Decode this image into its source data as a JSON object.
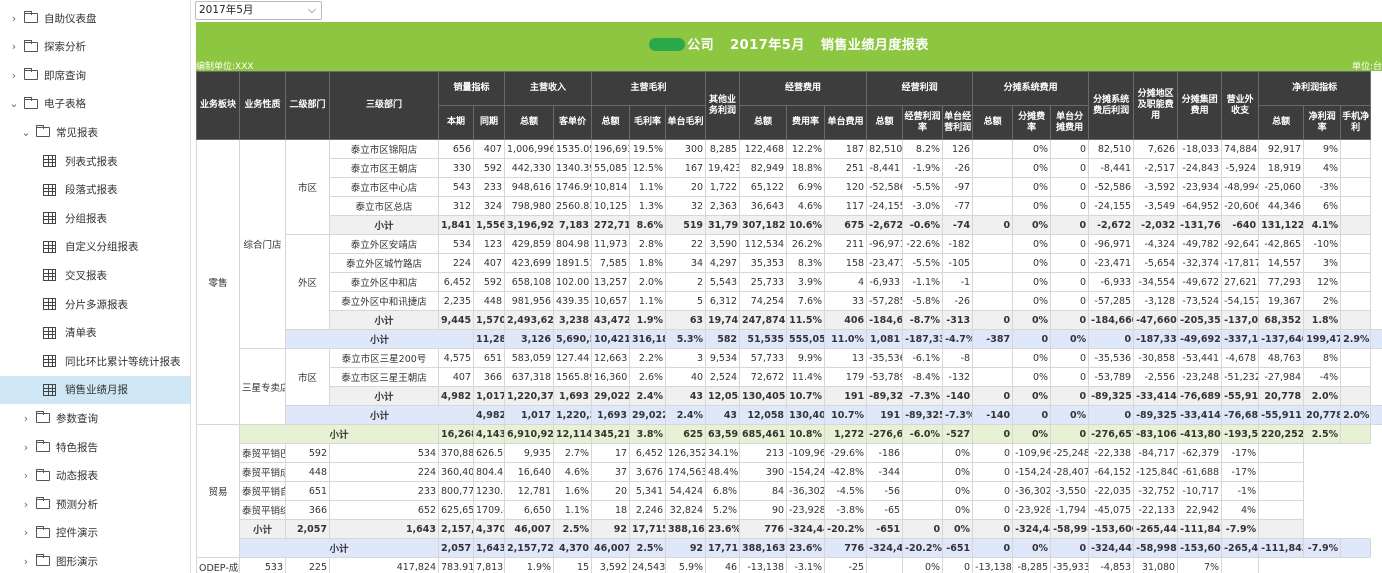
{
  "sidebar": {
    "items": [
      {
        "label": "自助仪表盘",
        "type": "folder",
        "level": 0,
        "chev": "›"
      },
      {
        "label": "探索分析",
        "type": "folder",
        "level": 0,
        "chev": "›"
      },
      {
        "label": "即席查询",
        "type": "folder",
        "level": 0,
        "chev": "›"
      },
      {
        "label": "电子表格",
        "type": "folder",
        "level": 0,
        "chev": "⌄"
      },
      {
        "label": "常见报表",
        "type": "folder",
        "level": 1,
        "chev": "⌄"
      },
      {
        "label": "列表式报表",
        "type": "report",
        "level": 2
      },
      {
        "label": "段落式报表",
        "type": "report",
        "level": 2
      },
      {
        "label": "分组报表",
        "type": "report",
        "level": 2
      },
      {
        "label": "自定义分组报表",
        "type": "report",
        "level": 2
      },
      {
        "label": "交叉报表",
        "type": "report",
        "level": 2
      },
      {
        "label": "分片多源报表",
        "type": "report",
        "level": 2
      },
      {
        "label": "清单表",
        "type": "report",
        "level": 2
      },
      {
        "label": "同比环比累计等统计报表",
        "type": "report",
        "level": 2
      },
      {
        "label": "销售业绩月报",
        "type": "report",
        "level": 2,
        "selected": true
      },
      {
        "label": "参数查询",
        "type": "folder",
        "level": 1,
        "chev": "›"
      },
      {
        "label": "特色报告",
        "type": "folder",
        "level": 1,
        "chev": "›"
      },
      {
        "label": "动态报表",
        "type": "folder",
        "level": 1,
        "chev": "›"
      },
      {
        "label": "预测分析",
        "type": "folder",
        "level": 1,
        "chev": "›"
      },
      {
        "label": "控件演示",
        "type": "folder",
        "level": 1,
        "chev": "›"
      },
      {
        "label": "图形演示",
        "type": "folder",
        "level": 1,
        "chev": "›"
      }
    ]
  },
  "date_select": {
    "value": "2017年5月",
    "arrow": "⌵"
  },
  "report": {
    "title_company": "公司",
    "title_month": "2017年5月",
    "title_name": "销售业绩月度报表",
    "unit_left": "编制单位:XXX",
    "unit_right": "单位:台",
    "header_top": [
      "业务板块",
      "业务性质",
      "二级部门",
      "三级部门",
      "销量指标",
      "主营收入",
      "主营毛利",
      "其他业务利润",
      "经营费用",
      "经营利润",
      "分摊系统费用",
      "分摊系统费后利润",
      "分摊地区及职能费用",
      "分摊集团费用",
      "营业外收支",
      "净利润指标"
    ],
    "header_sub": [
      "本期",
      "同期",
      "总额",
      "客单价",
      "总额",
      "毛利率",
      "单台毛利",
      "总额",
      "费用率",
      "单台费用",
      "总额",
      "经营利润率",
      "单台经营利润",
      "总额",
      "分摊费率",
      "单台分摊费用",
      "总额",
      "净利润率",
      "手机净利"
    ],
    "rows": [
      {
        "k": "d",
        "c3": "泰立市区锦阳店",
        "v": [
          "656",
          "407",
          "1,006,996",
          "1535.05",
          "196,693",
          "19.5%",
          "300",
          "8,285",
          "122,468",
          "12.2%",
          "187",
          "82,510",
          "8.2%",
          "126",
          "",
          "0%",
          "0",
          "82,510",
          "7,626",
          "-18,033",
          "74,884",
          "92,917",
          "9%",
          ""
        ]
      },
      {
        "k": "d",
        "c3": "泰立市区王朝店",
        "v": [
          "330",
          "592",
          "442,330",
          "1340.39",
          "55,085",
          "12.5%",
          "167",
          "19,423",
          "82,949",
          "18.8%",
          "251",
          "-8,441",
          "-1.9%",
          "-26",
          "",
          "0%",
          "0",
          "-8,441",
          "-2,517",
          "-24,843",
          "-5,924",
          "18,919",
          "4%",
          ""
        ]
      },
      {
        "k": "d",
        "c3": "泰立市区中心店",
        "v": [
          "543",
          "233",
          "948,616",
          "1746.99",
          "10,814",
          "1.1%",
          "20",
          "1,722",
          "65,122",
          "6.9%",
          "120",
          "-52,586",
          "-5.5%",
          "-97",
          "",
          "0%",
          "0",
          "-52,586",
          "-3,592",
          "-23,934",
          "-48,994",
          "-25,060",
          "-3%",
          ""
        ]
      },
      {
        "k": "d",
        "c3": "泰立市区总店",
        "v": [
          "312",
          "324",
          "798,980",
          "2560.83",
          "10,125",
          "1.3%",
          "32",
          "2,363",
          "36,643",
          "4.6%",
          "117",
          "-24,155",
          "-3.0%",
          "-77",
          "",
          "0%",
          "0",
          "-24,155",
          "-3,549",
          "-64,952",
          "-20,606",
          "44,346",
          "6%",
          ""
        ]
      },
      {
        "k": "s",
        "c3": "小计",
        "v": [
          "1,841",
          "1,556",
          "3,196,922",
          "7,183",
          "272,717",
          "8.6%",
          "519",
          "31,793",
          "307,182",
          "10.6%",
          "675",
          "-2,672",
          "-0.6%",
          "-74",
          "0",
          "0%",
          "0",
          "-2,672",
          "-2,032",
          "-131,762",
          "-640",
          "131,122",
          "4.1%",
          ""
        ]
      },
      {
        "k": "d",
        "c3": "泰立外区安靖店",
        "v": [
          "534",
          "123",
          "429,859",
          "804.98",
          "11,973",
          "2.8%",
          "22",
          "3,590",
          "112,534",
          "26.2%",
          "211",
          "-96,971",
          "-22.6%",
          "-182",
          "",
          "0%",
          "0",
          "-96,971",
          "-4,324",
          "-49,782",
          "-92,647",
          "-42,865",
          "-10%",
          ""
        ]
      },
      {
        "k": "d",
        "c3": "泰立外区城竹路店",
        "v": [
          "224",
          "407",
          "423,699",
          "1891.51",
          "7,585",
          "1.8%",
          "34",
          "4,297",
          "35,353",
          "8.3%",
          "158",
          "-23,471",
          "-5.5%",
          "-105",
          "",
          "0%",
          "0",
          "-23,471",
          "-5,654",
          "-32,374",
          "-17,817",
          "14,557",
          "3%",
          ""
        ]
      },
      {
        "k": "d",
        "c3": "泰立外区中和店",
        "v": [
          "6,452",
          "592",
          "658,108",
          "102.00",
          "13,257",
          "2.0%",
          "2",
          "5,543",
          "25,733",
          "3.9%",
          "4",
          "-6,933",
          "-1.1%",
          "-1",
          "",
          "0%",
          "0",
          "-6,933",
          "-34,554",
          "-49,672",
          "27,621",
          "77,293",
          "12%",
          ""
        ]
      },
      {
        "k": "d",
        "c3": "泰立外区中和讯捷店",
        "v": [
          "2,235",
          "448",
          "981,956",
          "439.35",
          "10,657",
          "1.1%",
          "5",
          "6,312",
          "74,254",
          "7.6%",
          "33",
          "-57,285",
          "-5.8%",
          "-26",
          "",
          "0%",
          "0",
          "-57,285",
          "-3,128",
          "-73,524",
          "-54,157",
          "19,367",
          "2%",
          ""
        ]
      },
      {
        "k": "s",
        "c3": "小计",
        "v": [
          "9,445",
          "1,570",
          "2,493,622",
          "3,238",
          "43,472",
          "1.9%",
          "63",
          "19,742",
          "247,874",
          "11.5%",
          "406",
          "-184,660",
          "-8.7%",
          "-313",
          "0",
          "0%",
          "0",
          "-184,660",
          "-47,660",
          "-205,352",
          "-137,000",
          "68,352",
          "1.8%",
          ""
        ]
      },
      {
        "k": "b",
        "c3": "小计",
        "v": [
          "11,286",
          "3,126",
          "5,690,544",
          "10,421",
          "316,189",
          "5.3%",
          "582",
          "51,535",
          "555,056",
          "11.0%",
          "1,081",
          "-187,332",
          "-4.7%",
          "-387",
          "0",
          "0%",
          "0",
          "-187,332",
          "-49,692",
          "-337,114",
          "-137,640",
          "199,473",
          "2.9%",
          ""
        ]
      },
      {
        "k": "d",
        "c3": "泰立市区三星200号",
        "v": [
          "4,575",
          "651",
          "583,059",
          "127.44",
          "12,663",
          "2.2%",
          "3",
          "9,534",
          "57,733",
          "9.9%",
          "13",
          "-35,536",
          "-6.1%",
          "-8",
          "",
          "0%",
          "0",
          "-35,536",
          "-30,858",
          "-53,441",
          "-4,678",
          "48,763",
          "8%",
          ""
        ]
      },
      {
        "k": "d",
        "c3": "泰立市区三星王朝店",
        "v": [
          "407",
          "366",
          "637,318",
          "1565.89",
          "16,360",
          "2.6%",
          "40",
          "2,524",
          "72,672",
          "11.4%",
          "179",
          "-53,789",
          "-8.4%",
          "-132",
          "",
          "0%",
          "0",
          "-53,789",
          "-2,556",
          "-23,248",
          "-51,232",
          "-27,984",
          "-4%",
          ""
        ]
      },
      {
        "k": "s",
        "c3": "小计",
        "v": [
          "4,982",
          "1,017",
          "1,220,377",
          "1,693",
          "29,022",
          "2.4%",
          "43",
          "12,058",
          "130,405",
          "10.7%",
          "191",
          "-89,325",
          "-7.3%",
          "-140",
          "0",
          "0%",
          "0",
          "-89,325",
          "-33,414",
          "-76,689",
          "-55,911",
          "20,778",
          "2.0%",
          ""
        ]
      },
      {
        "k": "b",
        "c3": "小计",
        "v": [
          "4,982",
          "1,017",
          "1,220,377",
          "1,693",
          "29,022",
          "2.4%",
          "43",
          "12,058",
          "130,405",
          "10.7%",
          "191",
          "-89,325",
          "-7.3%",
          "-140",
          "0",
          "0%",
          "0",
          "-89,325",
          "-33,414",
          "-76,689",
          "-55,911",
          "20,778",
          "2.0%",
          ""
        ]
      },
      {
        "k": "g",
        "c3": "小计",
        "v": [
          "16,268",
          "4,143",
          "6,910,921",
          "12,114",
          "345,211",
          "3.8%",
          "625",
          "63,593",
          "685,461",
          "10.8%",
          "1,272",
          "-276,657",
          "-6.0%",
          "-527",
          "0",
          "0%",
          "0",
          "-276,657",
          "-83,106",
          "-413,803",
          "-193,551",
          "220,252",
          "2.5%",
          ""
        ]
      },
      {
        "k": "d",
        "c3": "泰贸平销巴中地区",
        "v": [
          "592",
          "534",
          "370,888",
          "626.50",
          "9,935",
          "2.7%",
          "17",
          "6,452",
          "126,352",
          "34.1%",
          "213",
          "-109,965",
          "-29.6%",
          "-186",
          "",
          "0%",
          "0",
          "-109,965",
          "-25,248",
          "-22,338",
          "-84,717",
          "-62,379",
          "-17%",
          ""
        ]
      },
      {
        "k": "d",
        "c3": "泰贸平销成都市区",
        "v": [
          "448",
          "224",
          "360,404",
          "804.47",
          "16,640",
          "4.6%",
          "37",
          "3,676",
          "174,563",
          "48.4%",
          "390",
          "-154,247",
          "-42.8%",
          "-344",
          "",
          "0%",
          "0",
          "-154,247",
          "-28,407",
          "-64,152",
          "-125,840",
          "-61,688",
          "-17%",
          ""
        ]
      },
      {
        "k": "d",
        "c3": "泰贸平销自贡地区",
        "v": [
          "651",
          "233",
          "800,776",
          "1230.07",
          "12,781",
          "1.6%",
          "20",
          "5,341",
          "54,424",
          "6.8%",
          "84",
          "-36,302",
          "-4.5%",
          "-56",
          "",
          "0%",
          "0",
          "-36,302",
          "-3,550",
          "-22,035",
          "-32,752",
          "-10,717",
          "-1%",
          ""
        ]
      },
      {
        "k": "d",
        "c3": "泰贸平销综合事务部",
        "v": [
          "366",
          "652",
          "625,657",
          "1709.45",
          "6,650",
          "1.1%",
          "18",
          "2,246",
          "32,824",
          "5.2%",
          "90",
          "-23,928",
          "-3.8%",
          "-65",
          "",
          "0%",
          "0",
          "-23,928",
          "-1,794",
          "-45,075",
          "-22,133",
          "22,942",
          "4%",
          ""
        ]
      },
      {
        "k": "s",
        "c3": "小计",
        "v": [
          "2,057",
          "1,643",
          "2,157,725",
          "4,370",
          "46,007",
          "2.5%",
          "92",
          "17,715",
          "388,163",
          "23.6%",
          "776",
          "-324,441",
          "-20.2%",
          "-651",
          "0",
          "0%",
          "0",
          "-324,441",
          "-58,998",
          "-153,600",
          "-265,443",
          "-111,843",
          "-7.9%",
          ""
        ]
      },
      {
        "k": "b",
        "c3": "小计",
        "v": [
          "2,057",
          "1,643",
          "2,157,725",
          "4,370",
          "46,007",
          "2.5%",
          "92",
          "17,715",
          "388,163",
          "23.6%",
          "776",
          "-324,441",
          "-20.2%",
          "-651",
          "0",
          "0%",
          "0",
          "-324,441",
          "-58,998",
          "-153,600",
          "-265,443",
          "-111,843",
          "-7.9%",
          ""
        ]
      },
      {
        "k": "d",
        "c3": "ODEP-成都OPEN",
        "v": [
          "533",
          "225",
          "417,824",
          "783.91",
          "7,813",
          "1.9%",
          "15",
          "3,592",
          "24,543",
          "5.9%",
          "46",
          "-13,138",
          "-3.1%",
          "-25",
          "",
          "0%",
          "0",
          "-13,138",
          "-8,285",
          "-35,933",
          "-4,853",
          "31,080",
          "7%",
          ""
        ]
      }
    ],
    "col1": [
      "零售",
      "贸易"
    ],
    "col2": [
      "综合门店",
      "三星专卖店",
      "平销"
    ],
    "col3": [
      "市区",
      "外区",
      "市区",
      "泰贸平销"
    ]
  }
}
